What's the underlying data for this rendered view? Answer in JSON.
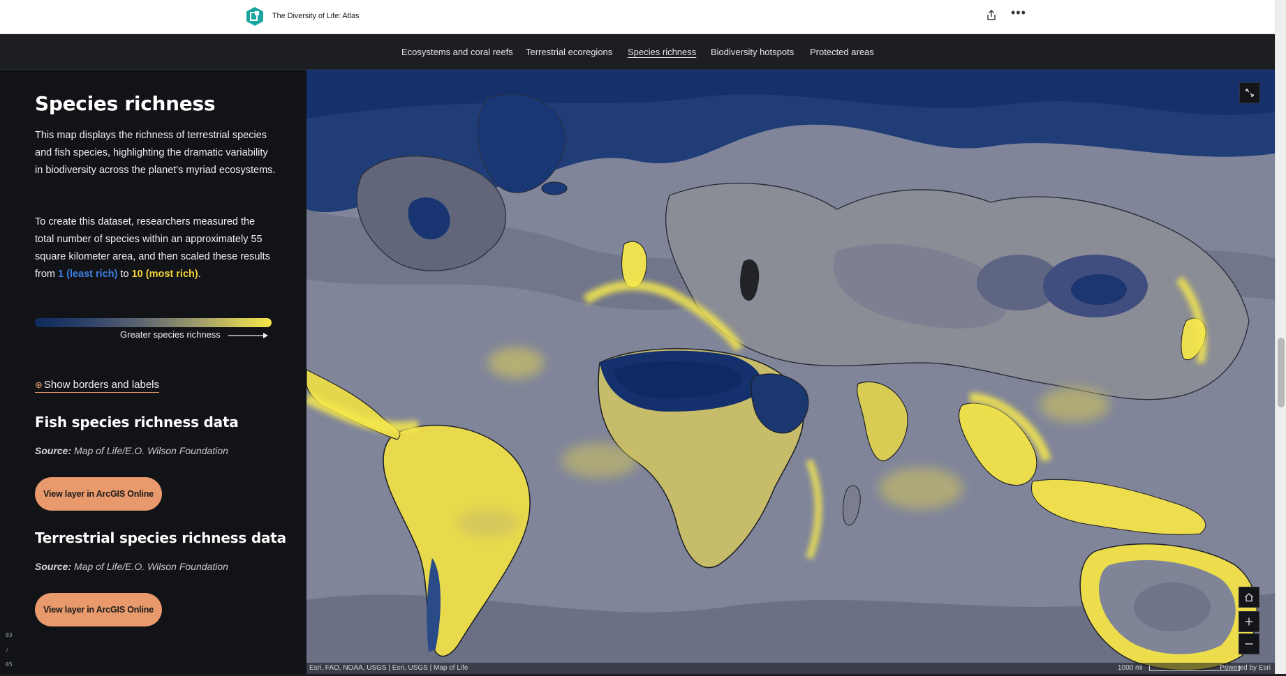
{
  "header": {
    "app_title": "The Diversity of Life: Atlas",
    "icons": [
      "storymap-logo-icon",
      "share-icon",
      "more-options-icon"
    ]
  },
  "nav": {
    "items": [
      {
        "label": "Ecosystems and coral reefs",
        "active": false
      },
      {
        "label": "Terrestrial ecoregions",
        "active": false
      },
      {
        "label": "Species richness",
        "active": true
      },
      {
        "label": "Biodiversity hotspots",
        "active": false
      },
      {
        "label": "Protected areas",
        "active": false
      }
    ]
  },
  "sidebar": {
    "title": "Species richness",
    "paragraph1": "This map displays the richness of terrestrial species and fish species, highlighting the dramatic variability in biodiversity across the planet's myriad ecosystems.",
    "paragraph2_pre": "To create this dataset, researchers measured the total number of species within an approximately 55 square kilometer area, and then scaled these results from ",
    "paragraph2_low": "1 (least rich)",
    "paragraph2_mid": " to ",
    "paragraph2_high": "10 (most rich)",
    "paragraph2_post": ".",
    "legend_label": "Greater species richness",
    "toggle_label": "Show borders and labels",
    "sections": [
      {
        "heading": "Fish species richness data",
        "source_label": "Source:",
        "source_value": "Map of Life/E.O. Wilson Foundation",
        "button_label": "View layer in ArcGIS Online"
      },
      {
        "heading": "Terrestrial species richness data",
        "source_label": "Source:",
        "source_value": "Map of Life/E.O. Wilson Foundation",
        "button_label": "View layer in ArcGIS Online"
      }
    ],
    "pager": {
      "current": "03",
      "separator": "/",
      "total": "05"
    }
  },
  "map": {
    "attribution": "Esri, FAO, NOAA, USGS | Esri, USGS | Map of Life",
    "scale_label": "1000 mi",
    "powered_by": "Powered by Esri",
    "controls": [
      "expand-icon",
      "home-icon",
      "zoom-in-icon",
      "zoom-out-icon"
    ]
  },
  "colors": {
    "accent_orange": "#e89a6c",
    "low_blue": "#3f7fe0",
    "high_yellow": "#f3d23a",
    "ocean_grey": "#7f8496",
    "rich_yellow": "#f2e24c",
    "poor_navy": "#0f2d5e"
  }
}
